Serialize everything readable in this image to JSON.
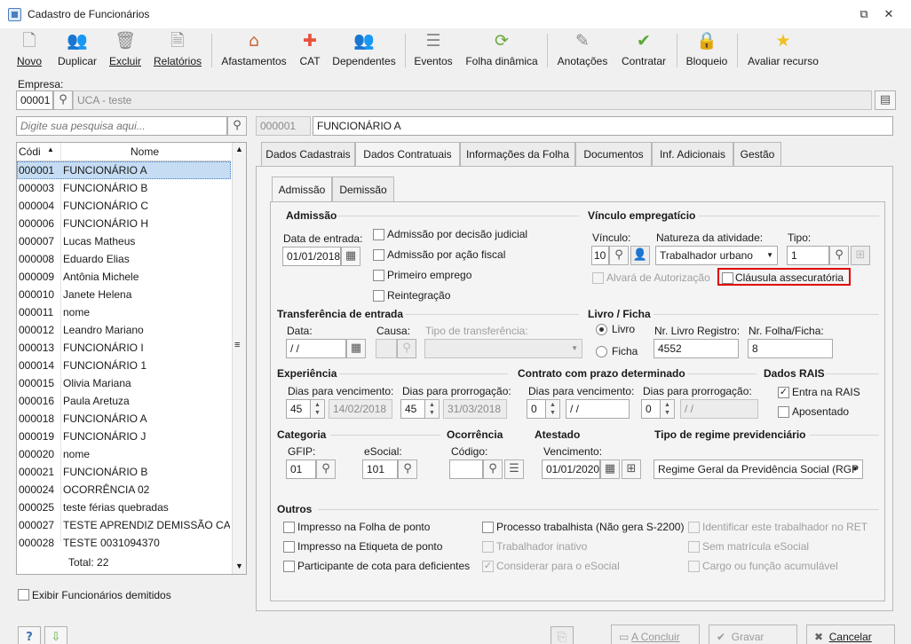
{
  "window": {
    "title": "Cadastro de Funcionários"
  },
  "toolbar": [
    {
      "label": "Novo",
      "icon": "new-icon",
      "glyph": "🗋"
    },
    {
      "label": "Duplicar",
      "icon": "duplicate-icon",
      "glyph": "👥"
    },
    {
      "label": "Excluir",
      "icon": "trash-icon",
      "glyph": "🗑"
    },
    {
      "label": "Relatórios",
      "icon": "report-icon",
      "glyph": "🗎"
    },
    {
      "label": "Afastamentos",
      "icon": "house-icon",
      "glyph": "⌂"
    },
    {
      "label": "CAT",
      "icon": "first-aid-icon",
      "glyph": "✚"
    },
    {
      "label": "Dependentes",
      "icon": "people-icon",
      "glyph": "👥"
    },
    {
      "label": "Eventos",
      "icon": "events-icon",
      "glyph": "☰"
    },
    {
      "label": "Folha dinâmica",
      "icon": "dynamic-sheet-icon",
      "glyph": "⟳"
    },
    {
      "label": "Anotações",
      "icon": "notes-icon",
      "glyph": "✎"
    },
    {
      "label": "Contratar",
      "icon": "hire-icon",
      "glyph": "✔"
    },
    {
      "label": "Bloqueio",
      "icon": "lock-icon",
      "glyph": "🔒"
    },
    {
      "label": "Avaliar recurso",
      "icon": "star-icon",
      "glyph": "★"
    }
  ],
  "empresa": {
    "label": "Empresa:",
    "code": "00001",
    "name": "UCA - teste"
  },
  "search": {
    "placeholder": "Digite sua pesquisa aqui..."
  },
  "current": {
    "code": "000001",
    "name": "FUNCIONÁRIO A"
  },
  "grid": {
    "col_code": "Códi",
    "col_name": "Nome",
    "total": "Total: 22",
    "rows": [
      [
        "000001",
        "FUNCIONÁRIO A"
      ],
      [
        "000003",
        "FUNCIONÁRIO B"
      ],
      [
        "000004",
        "FUNCIONÁRIO C"
      ],
      [
        "000006",
        "FUNCIONÁRIO H"
      ],
      [
        "000007",
        "Lucas Matheus"
      ],
      [
        "000008",
        "Eduardo Elias"
      ],
      [
        "000009",
        "Antônia Michele"
      ],
      [
        "000010",
        "Janete Helena"
      ],
      [
        "000011",
        "nome"
      ],
      [
        "000012",
        "Leandro Mariano"
      ],
      [
        "000013",
        "FUNCIONÁRIO I"
      ],
      [
        "000014",
        "FUNCIONÁRIO 1"
      ],
      [
        "000015",
        "Olivia Mariana"
      ],
      [
        "000016",
        "Paula Aretuza"
      ],
      [
        "000018",
        "FUNCIONÁRIO A"
      ],
      [
        "000019",
        "FUNCIONÁRIO J"
      ],
      [
        "000020",
        "nome"
      ],
      [
        "000021",
        "FUNCIONÁRIO B"
      ],
      [
        "000024",
        "OCORRÊNCIA 02"
      ],
      [
        "000025",
        "teste férias quebradas"
      ],
      [
        "000027",
        "TESTE APRENDIZ DEMISSÃO CAUSA"
      ],
      [
        "000028",
        "TESTE 0031094370"
      ]
    ]
  },
  "show_dismissed": "Exibir Funcionários demitidos",
  "tabs": [
    "Dados Cadastrais",
    "Dados Contratuais",
    "Informações da Folha",
    "Documentos",
    "Inf. Adicionais",
    "Gestão"
  ],
  "subtabs": [
    "Admissão",
    "Demissão"
  ],
  "admissao": {
    "title": "Admissão",
    "date_label": "Data de entrada:",
    "date": "01/01/2018",
    "checks": [
      "Admissão por decisão judicial",
      "Admissão por ação fiscal",
      "Primeiro emprego",
      "Reintegração"
    ]
  },
  "vinculo": {
    "title": "Vínculo empregatício",
    "vinculo_label": "Vínculo:",
    "vinculo": "10",
    "natureza_label": "Natureza da atividade:",
    "natureza": "Trabalhador urbano",
    "tipo_label": "Tipo:",
    "tipo": "1",
    "alvara": "Alvará de Autorização",
    "clausula": "Cláusula assecuratória"
  },
  "transferencia": {
    "title": "Transferência de entrada",
    "data_label": "Data:",
    "data": " /  /",
    "causa_label": "Causa:",
    "tipo_label": "Tipo de transferência:"
  },
  "livro": {
    "title": "Livro / Ficha",
    "livro": "Livro",
    "ficha": "Ficha",
    "nr_livro_label": "Nr. Livro Registro:",
    "nr_livro": "4552",
    "nr_folha_label": "Nr. Folha/Ficha:",
    "nr_folha": "8"
  },
  "experiencia": {
    "title": "Experiência",
    "venc_label": "Dias para vencimento:",
    "venc": "45",
    "venc_date": "14/02/2018",
    "prorr_label": "Dias para prorrogação:",
    "prorr": "45",
    "prorr_date": "31/03/2018"
  },
  "contrato": {
    "title": "Contrato com prazo determinado",
    "venc_label": "Dias para vencimento:",
    "venc": "0",
    "venc_date": " /  /",
    "prorr_label": "Dias para prorrogação:",
    "prorr": "0",
    "prorr_date": " /  /"
  },
  "rais": {
    "title": "Dados RAIS",
    "entra": "Entra na RAIS",
    "aposentado": "Aposentado"
  },
  "categoria": {
    "title": "Categoria",
    "gfip_label": "GFIP:",
    "gfip": "01",
    "esocial_label": "eSocial:",
    "esocial": "101"
  },
  "ocorrencia": {
    "title": "Ocorrência",
    "codigo_label": "Código:"
  },
  "atestado": {
    "title": "Atestado",
    "venc_label": "Vencimento:",
    "venc": "01/01/2020"
  },
  "regime": {
    "title": "Tipo de regime previdenciário",
    "value": "Regime Geral da Previdência Social (RGP"
  },
  "outros": {
    "title": "Outros",
    "items": [
      "Impresso na Folha de ponto",
      "Impresso na Etiqueta de ponto",
      "Participante de cota para deficientes",
      "Processo trabalhista (Não gera S-2200)",
      "Trabalhador inativo",
      "Considerar para o eSocial",
      "Identificar este trabalhador no RET",
      "Sem matrícula eSocial",
      "Cargo ou função acumulável"
    ]
  },
  "footer": {
    "concluir": "A Concluir",
    "gravar": "Gravar",
    "cancelar": "Cancelar"
  },
  "colors": {
    "highlight": "#e00000",
    "selection": "#c5dcf3"
  }
}
